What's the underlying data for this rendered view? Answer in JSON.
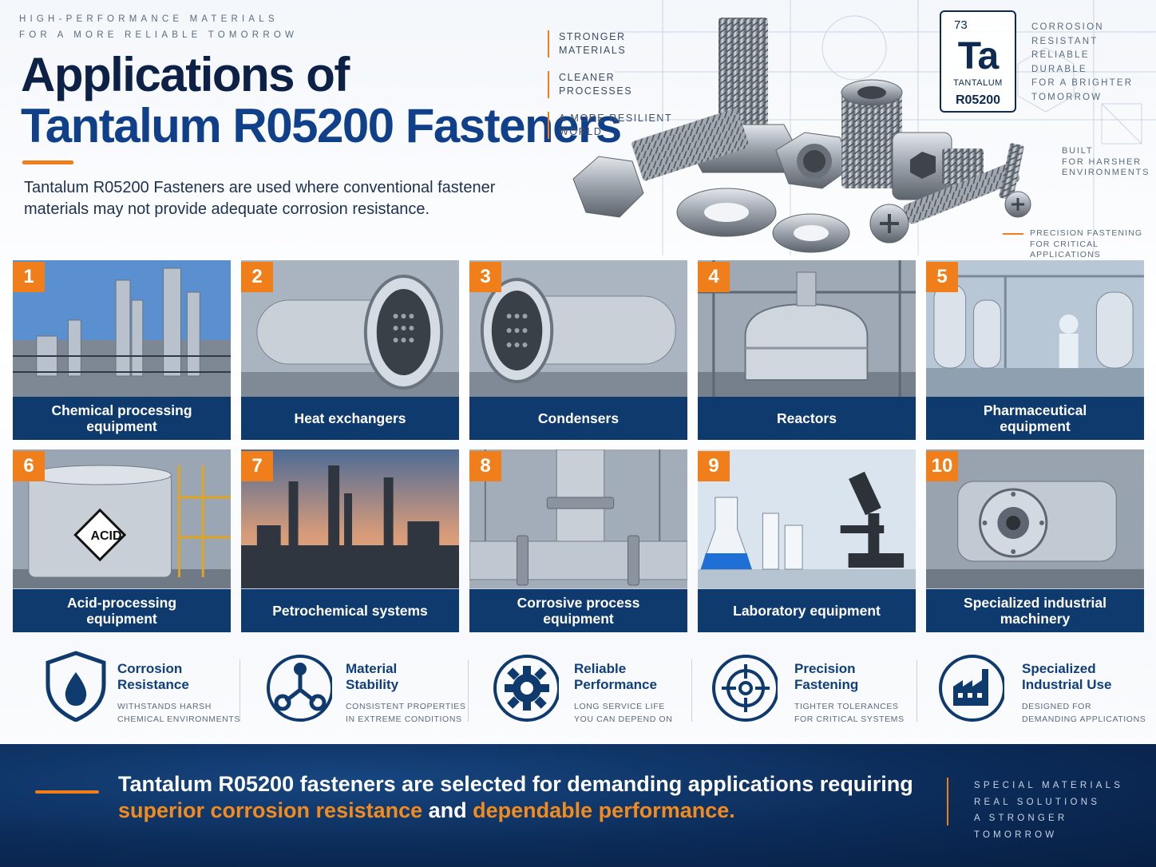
{
  "header": {
    "tagline": [
      "HIGH-PERFORMANCE MATERIALS",
      "FOR A MORE RELIABLE TOMORROW"
    ],
    "title_line1": "Applications of",
    "title_line2": "Tantalum R05200 Fasteners",
    "intro": "Tantalum R05200 Fasteners are used where conventional fastener materials may not provide adequate corrosion resistance."
  },
  "benefits": [
    "STRONGER\nMATERIALS",
    "CLEANER\nPROCESSES",
    "A MORE RESILIENT\nWORLD"
  ],
  "element": {
    "number": "73",
    "symbol": "Ta",
    "name": "TANTALUM",
    "grade": "R05200"
  },
  "properties": [
    "CORROSION",
    "RESISTANT",
    "RELIABLE",
    "DURABLE",
    "FOR A BRIGHTER",
    "TOMORROW"
  ],
  "built_note": "BUILT\nFOR HARSHER\nENVIRONMENTS",
  "precision_note": "PRECISION FASTENING\nFOR CRITICAL APPLICATIONS",
  "applications": [
    {
      "number": "1",
      "label": "Chemical processing\nequipment"
    },
    {
      "number": "2",
      "label": "Heat exchangers"
    },
    {
      "number": "3",
      "label": "Condensers"
    },
    {
      "number": "4",
      "label": "Reactors"
    },
    {
      "number": "5",
      "label": "Pharmaceutical\nequipment"
    },
    {
      "number": "6",
      "label": "Acid-processing\nequipment",
      "sign": "ACID"
    },
    {
      "number": "7",
      "label": "Petrochemical systems"
    },
    {
      "number": "8",
      "label": "Corrosive process\nequipment"
    },
    {
      "number": "9",
      "label": "Laboratory equipment"
    },
    {
      "number": "10",
      "label": "Specialized industrial\nmachinery"
    }
  ],
  "features": [
    {
      "title": "Corrosion\nResistance",
      "desc": "WITHSTANDS HARSH\nCHEMICAL ENVIRONMENTS",
      "icon": "shield-drop-icon"
    },
    {
      "title": "Material\nStability",
      "desc": "CONSISTENT PROPERTIES\nIN EXTREME CONDITIONS",
      "icon": "molecule-icon"
    },
    {
      "title": "Reliable\nPerformance",
      "desc": "LONG SERVICE LIFE\nYOU CAN DEPEND ON",
      "icon": "gear-icon"
    },
    {
      "title": "Precision\nFastening",
      "desc": "TIGHTER TOLERANCES\nFOR CRITICAL SYSTEMS",
      "icon": "crosshair-icon"
    },
    {
      "title": "Specialized\nIndustrial Use",
      "desc": "DESIGNED FOR\nDEMANDING APPLICATIONS",
      "icon": "factory-icon"
    }
  ],
  "footer": {
    "statement_part1": "Tantalum R05200 fasteners are selected for demanding applications requiring ",
    "highlight1": "superior corrosion resistance",
    "statement_part2": " and ",
    "highlight2": "dependable performance.",
    "motto": [
      "SPECIAL MATERIALS",
      "REAL SOLUTIONS",
      "A STRONGER TOMORROW"
    ]
  },
  "colors": {
    "navy": "#0f3a6e",
    "accent_orange": "#f07f1b",
    "title_blue": "#10408a"
  }
}
